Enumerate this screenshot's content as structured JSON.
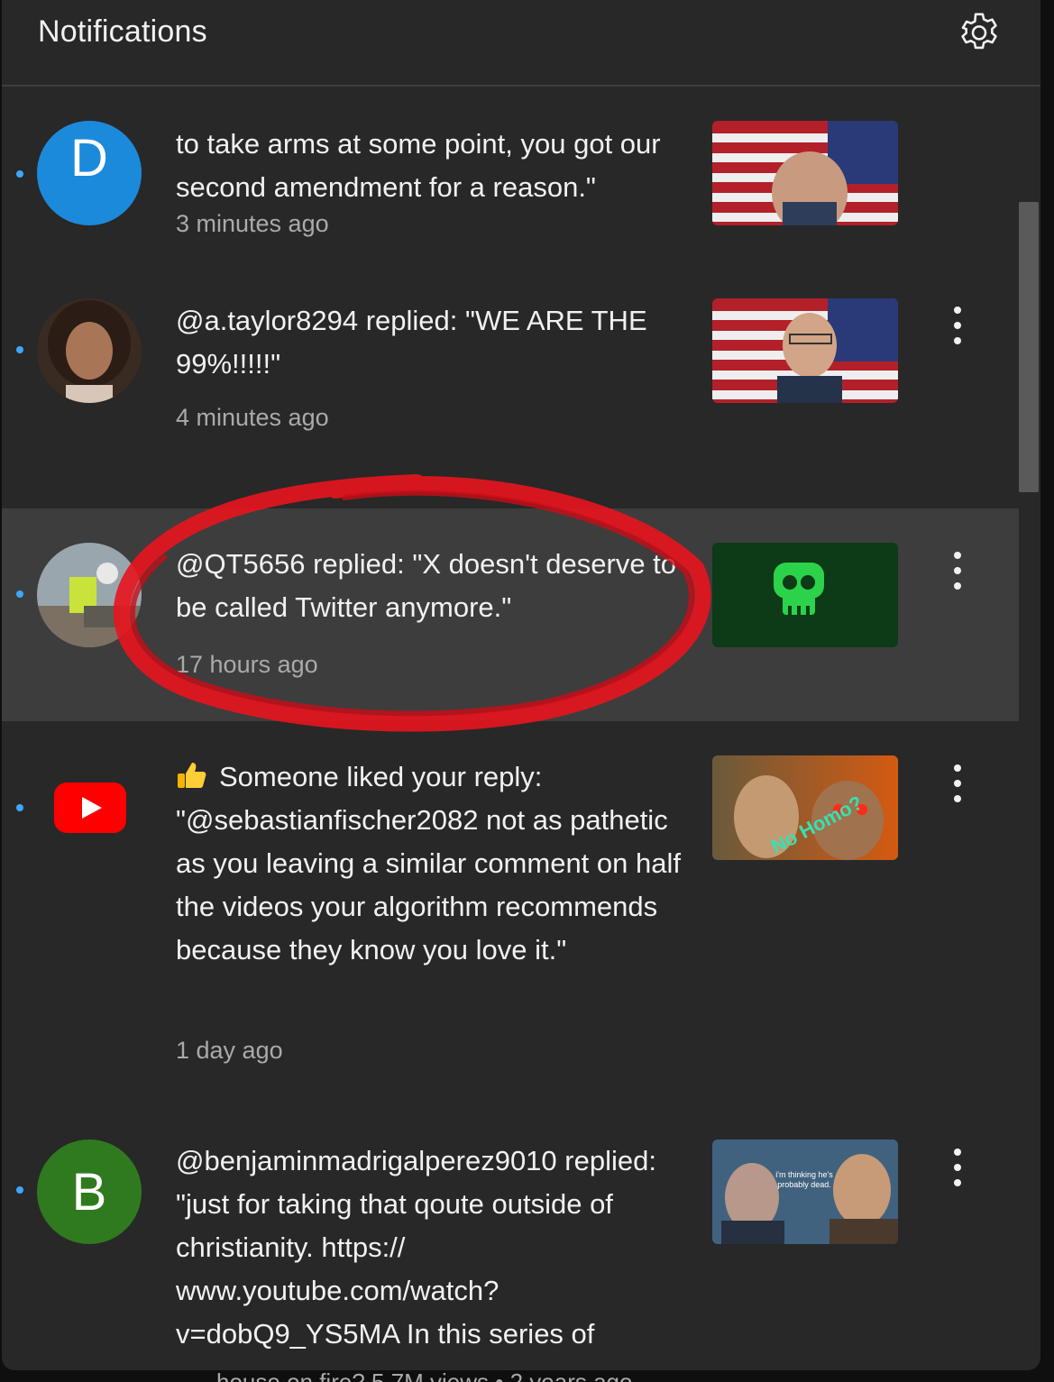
{
  "header": {
    "title": "Notifications",
    "settings_icon": "gear-icon"
  },
  "notifications": [
    {
      "avatar_letter": "D",
      "avatar_color": "#1c8adb",
      "message": "to take arms at some point, you got our second amendment for a reason.\"",
      "time": "3 minutes ago"
    },
    {
      "message": "@a.taylor8294 replied: \"WE ARE THE 99%!!!!!\"",
      "time": "4 minutes ago"
    },
    {
      "message": "@QT5656 replied: \"X doesn't deserve to be called Twitter anymore.\"",
      "time": "17 hours ago",
      "highlighted": true
    },
    {
      "icon": "thumbs-up-icon",
      "message": "Someone liked your reply: \"@sebastianfischer2082 not as pathetic as you leaving a similar comment on half the videos your algorithm recommends because they know you love it.\"",
      "time": "1 day ago",
      "thumb_text": "No Homo?"
    },
    {
      "avatar_letter": "B",
      "avatar_color": "#2f7a1f",
      "message": "@benjaminmadrigalperez9010 replied: \"just for taking that qoute outside of christianity. https:// www.youtube.com/watch? v=dobQ9_YS5MA In this series of",
      "thumb_text": "i'm thinking he's probably dead."
    }
  ],
  "background_text": "house on fire?        5.7M views  •  2 years ago",
  "colors": {
    "accent_dot": "#3ea6ff",
    "annotation_circle": "#e8141e"
  }
}
